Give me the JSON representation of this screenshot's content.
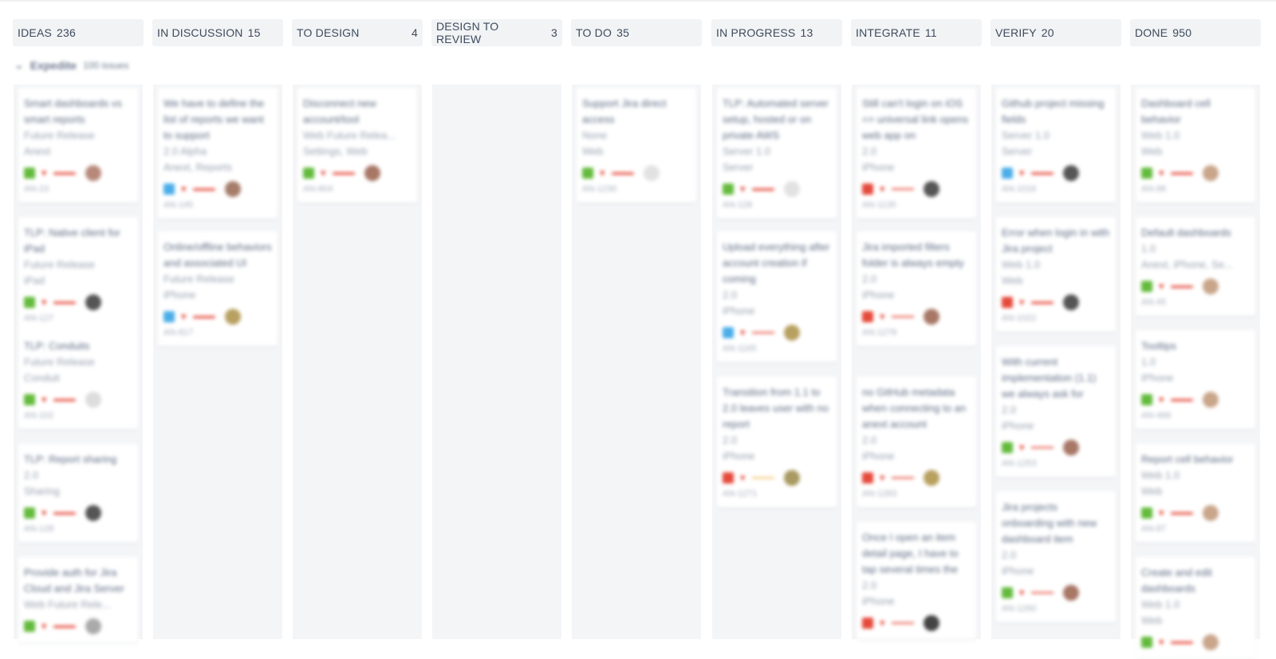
{
  "columns": [
    {
      "name": "IDEAS",
      "count": "236"
    },
    {
      "name": "IN DISCUSSION",
      "count": "15"
    },
    {
      "name": "TO DESIGN",
      "count": "4"
    },
    {
      "name": "DESIGN TO REVIEW",
      "count": "3"
    },
    {
      "name": "TO DO",
      "count": "35"
    },
    {
      "name": "IN PROGRESS",
      "count": "13"
    },
    {
      "name": "INTEGRATE",
      "count": "11"
    },
    {
      "name": "VERIFY",
      "count": "20"
    },
    {
      "name": "DONE",
      "count": "950"
    }
  ],
  "swimlane": {
    "name": "Expedite",
    "count": "100 issues"
  },
  "cards": {
    "ideas": [
      {
        "summary": "Smart dashboards vs smart reports",
        "meta": [
          "Future Release",
          "Anext"
        ],
        "key": "AN-23",
        "type": "story",
        "prio": "bar",
        "avatar": "#b8897a"
      },
      {
        "summary": "TLP: Native client for iPad",
        "meta": [
          "Future Release",
          "iPad"
        ],
        "key": "AN-127",
        "type": "story",
        "prio": "bar",
        "avatar": "#555555"
      },
      {
        "summary": "TLP: Conduits",
        "meta": [
          "Future Release",
          "Conduit"
        ],
        "key": "AN-102",
        "type": "story",
        "prio": "bar",
        "avatar": "#dddddd"
      },
      {
        "summary": "TLP: Report sharing",
        "meta": [
          "2.0",
          "Sharing"
        ],
        "key": "AN-128",
        "type": "story",
        "prio": "bar",
        "avatar": "#555555"
      },
      {
        "summary": "Provide auth for Jira Cloud and Jira Server",
        "meta": [
          "Web Future Rele..."
        ],
        "key": "",
        "type": "story",
        "prio": "bar",
        "avatar": "#aaaaaa"
      }
    ],
    "discussion": [
      {
        "summary": "We have to define the list of reports we want to support",
        "meta": [
          "2.0 Alpha",
          "Anext, Reports"
        ],
        "key": "AN-145",
        "type": "task",
        "prio": "bar",
        "avatar": "#a67d6a"
      },
      {
        "summary": "Online/offline behaviors and associated UI",
        "meta": [
          "Future Release",
          "iPhone"
        ],
        "key": "AN-817",
        "type": "task",
        "prio": "bar",
        "avatar": "#b8a060"
      }
    ],
    "design": [
      {
        "summary": "Disconnect new account/tool",
        "meta": [
          "Web Future Relea...",
          "Settings, Web"
        ],
        "key": "AN-804",
        "type": "story",
        "prio": "bar",
        "avatar": "#a87766"
      }
    ],
    "todo": [
      {
        "summary": "Support Jira direct access",
        "meta": [
          "None",
          "Web"
        ],
        "key": "AN-1230",
        "type": "story",
        "prio": "bar",
        "avatar": "#e2e2e2"
      }
    ],
    "progress": [
      {
        "summary": "TLP: Automated server setup, hosted or on private AWS",
        "meta": [
          "Server 1.0",
          "Server"
        ],
        "key": "AN-128",
        "type": "story",
        "prio": "bar",
        "avatar": "#e2e2e2"
      },
      {
        "summary": "Upload everything after account creation if coming",
        "meta": [
          "2.0",
          "iPhone"
        ],
        "key": "AN-1165",
        "type": "task",
        "prio": "arrow",
        "avatar": "#b8a060"
      },
      {
        "summary": "Transition from 1.1 to 2.0 leaves user with no report",
        "meta": [
          "2.0",
          "iPhone"
        ],
        "key": "AN-1271",
        "type": "bug",
        "prio": "arrow-medium",
        "avatar": "#a89a60"
      }
    ],
    "integrate": [
      {
        "summary": "Still can't login on iOS => universal link opens web app on",
        "meta": [
          "2.0",
          "iPhone"
        ],
        "key": "AN-1135",
        "type": "bug",
        "prio": "arrow",
        "avatar": "#555555"
      },
      {
        "summary": "Jira imported filters folder is always empty",
        "meta": [
          "2.0",
          "iPhone"
        ],
        "key": "AN-1278",
        "type": "bug",
        "prio": "arrow",
        "avatar": "#a87766"
      },
      {
        "summary": "no GitHub metadata when connecting to an anext account",
        "meta": [
          "2.0",
          "iPhone"
        ],
        "key": "AN-1283",
        "type": "bug",
        "prio": "arrow",
        "avatar": "#b8a060"
      },
      {
        "summary": "Once I open an item detail page, I have to tap several times the",
        "meta": [
          "2.0",
          "iPhone"
        ],
        "key": "",
        "type": "bug",
        "prio": "arrow",
        "avatar": "#444444"
      }
    ],
    "verify": [
      {
        "summary": "Github project missing fields",
        "meta": [
          "Server 1.0",
          "Server"
        ],
        "key": "AN-1016",
        "type": "task",
        "prio": "bar",
        "avatar": "#555555"
      },
      {
        "summary": "Error when login in with Jira project",
        "meta": [
          "Web 1.0",
          "Web"
        ],
        "key": "AN-1022",
        "type": "bug",
        "prio": "bar",
        "avatar": "#555555"
      },
      {
        "summary": "With current implementation (1.1) we always ask for",
        "meta": [
          "2.0",
          "iPhone"
        ],
        "key": "AN-1253",
        "type": "story",
        "prio": "arrow",
        "avatar": "#a87766"
      },
      {
        "summary": "Jira projects onboarding with new dashboard item",
        "meta": [
          "2.0",
          "iPhone"
        ],
        "key": "AN-1260",
        "type": "story",
        "prio": "arrow",
        "avatar": "#a87766"
      }
    ],
    "done": [
      {
        "summary": "Dashboard cell behavior",
        "meta": [
          "Web 1.0",
          "Web"
        ],
        "key": "AN-88",
        "type": "story",
        "prio": "bar",
        "avatar": "#c9a58a"
      },
      {
        "summary": "Default dashboards",
        "meta": [
          "1.0",
          "Anext, iPhone, Se..."
        ],
        "key": "AN-45",
        "type": "story",
        "prio": "bar",
        "avatar": "#c9a58a"
      },
      {
        "summary": "Tooltips",
        "meta": [
          "1.0",
          "iPhone"
        ],
        "key": "AN-468",
        "type": "story",
        "prio": "bar",
        "avatar": "#c9a58a"
      },
      {
        "summary": "Report cell behavior",
        "meta": [
          "Web 1.0",
          "Web"
        ],
        "key": "AN-87",
        "type": "story",
        "prio": "bar",
        "avatar": "#c9a58a"
      },
      {
        "summary": "Create and edit dashboards",
        "meta": [
          "Web 1.0",
          "Web"
        ],
        "key": "",
        "type": "story",
        "prio": "bar",
        "avatar": "#c9a58a"
      }
    ]
  }
}
